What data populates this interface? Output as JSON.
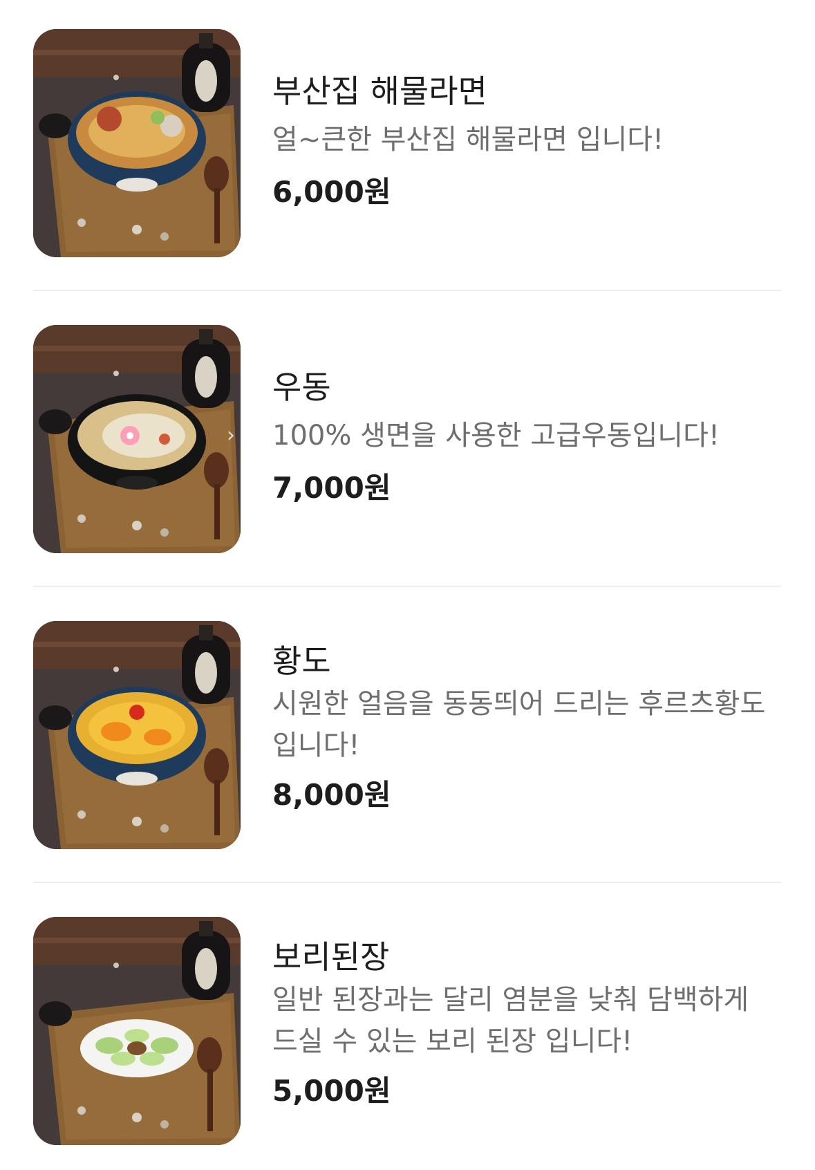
{
  "menu": {
    "items": [
      {
        "name": "부산집 해물라면",
        "description": "얼~큰한 부산집 해물라면 입니다!",
        "price": "6,000원",
        "dish": "ramen"
      },
      {
        "name": "우동",
        "description": "100% 생면을 사용한 고급우동입니다!",
        "price": "7,000원",
        "dish": "udon"
      },
      {
        "name": "황도",
        "description": "시원한 얼음을 동동띄어 드리는 후르츠황도 입니다!",
        "price": "8,000원",
        "dish": "peach"
      },
      {
        "name": "보리된장",
        "description": "일반 된장과는 달리 염분을 낮춰 담백하게 드실 수 있는 보리 된장 입니다!",
        "price": "5,000원",
        "dish": "doenjang"
      }
    ]
  },
  "colors": {
    "name_text": "#1d1d1d",
    "description_text": "#6e6e6e",
    "price_text": "#1d1d1d",
    "divider": "#efefef",
    "background": "#ffffff"
  }
}
